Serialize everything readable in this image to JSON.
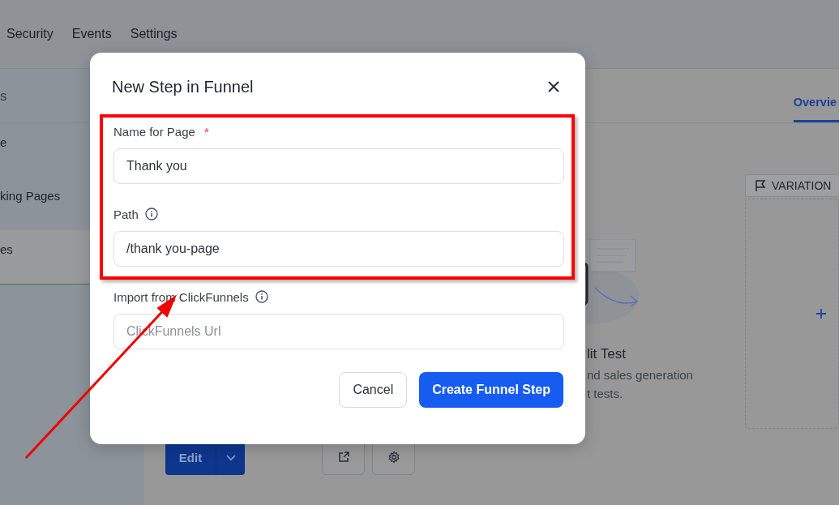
{
  "top_nav": {
    "items": [
      "Security",
      "Events",
      "Settings"
    ]
  },
  "sidebar": {
    "heading": "s",
    "items": [
      {
        "label": "e",
        "selected": false
      },
      {
        "label": "king Pages",
        "selected": false
      },
      {
        "label": "es",
        "selected": true
      }
    ]
  },
  "main": {
    "tabs": [
      {
        "label": "Overvie",
        "selected": true
      }
    ],
    "feature_title": "lit Test",
    "feature_text": [
      "nd sales generation",
      "t tests."
    ],
    "variation_label": "VARIATION",
    "edit_button": "Edit"
  },
  "modal": {
    "title": "New Step in Funnel",
    "fields": [
      {
        "label": "Name for Page",
        "required": true,
        "info": false,
        "value": "Thank you"
      },
      {
        "label": "Path",
        "required": false,
        "info": true,
        "value": "/thank you-page"
      },
      {
        "label": "Import from ClickFunnels",
        "required": false,
        "info": true,
        "placeholder": "ClickFunnels Url"
      }
    ],
    "required_mark": "*",
    "buttons": [
      {
        "label": "Cancel",
        "kind": "secondary"
      },
      {
        "label": "Create Funnel Step",
        "kind": "primary"
      }
    ]
  }
}
